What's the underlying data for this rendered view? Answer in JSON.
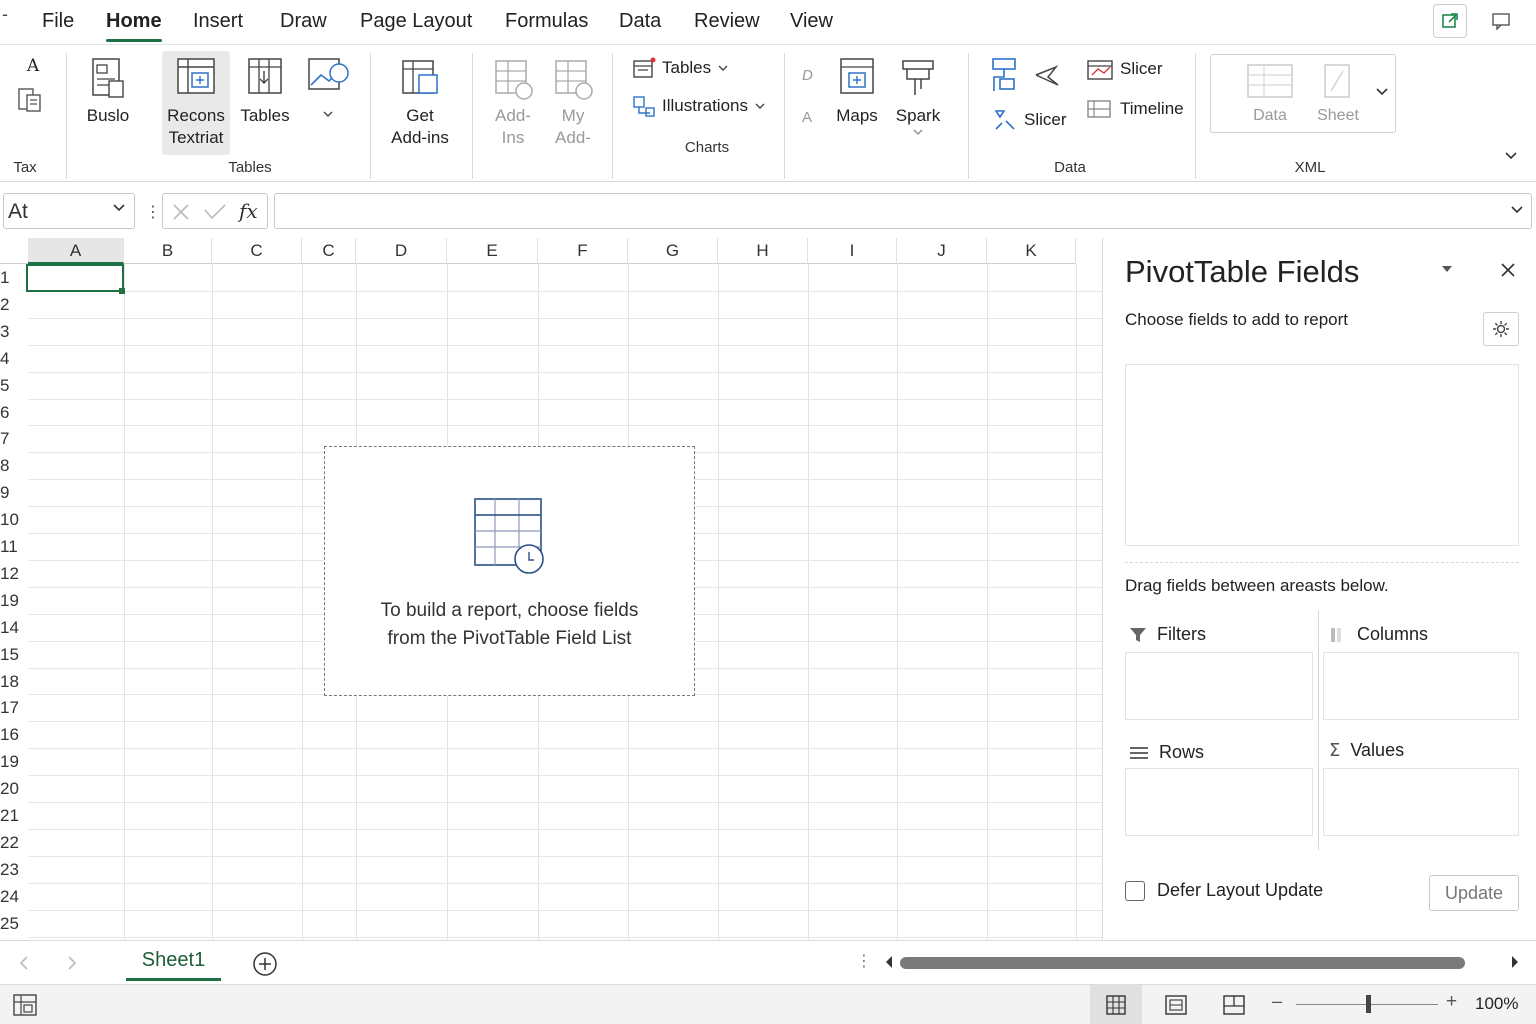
{
  "menubar": {
    "dash": "-",
    "tabs": [
      "File",
      "Home",
      "Insert",
      "Draw",
      "Page Layout",
      "Formulas",
      "Data",
      "Review",
      "View"
    ],
    "active_tab": "Home"
  },
  "ribbon": {
    "tax_group": {
      "icon_letter": "A",
      "label": "Tax"
    },
    "tables_group": {
      "buslo": "Buslo",
      "recons_line1": "Recons",
      "recons_line2": "Textriat",
      "tables": "Tables",
      "label": "Tables"
    },
    "addins_group": {
      "get_line1": "Get",
      "get_line2": "Add-ins",
      "addins_line1": "Add-",
      "addins_line2": "Ins",
      "my_line1": "My",
      "my_line2": "Add-"
    },
    "charts_group": {
      "tables": "Tables",
      "illustrations": "Illustrations",
      "label": "Charts"
    },
    "data_group": {
      "letter_d": "D",
      "letter_a": "A",
      "maps": "Maps",
      "spark": "Spark",
      "slicer_small": "Slicer",
      "slicer_top": "Slicer",
      "timeline": "Timeline",
      "label": "Data"
    },
    "xml_group": {
      "data": "Data",
      "sheet": "Sheet",
      "label": "XML"
    }
  },
  "formulabar": {
    "namebox": "At",
    "fx": "fx",
    "value": ""
  },
  "grid": {
    "columns": [
      "A",
      "B",
      "C",
      "C",
      "D",
      "E",
      "F",
      "G",
      "H",
      "I",
      "J",
      "K"
    ],
    "rows": [
      "1",
      "2",
      "3",
      "4",
      "5",
      "6",
      "7",
      "8",
      "9",
      "10",
      "11",
      "12",
      "19",
      "14",
      "15",
      "18",
      "17",
      "16",
      "19",
      "20",
      "21",
      "22",
      "23",
      "24",
      "25"
    ],
    "selected_column": "A",
    "placeholder": {
      "line1": "To build a report, choose fields",
      "line2": "from the PivotTable Field List"
    }
  },
  "pivot_pane": {
    "title": "PivotTable Fields",
    "subtitle": "Choose fields to add to report",
    "drag_text": "Drag fields between areasts below.",
    "areas": {
      "filters": "Filters",
      "columns": "Columns",
      "rows": "Rows",
      "values": "Values"
    },
    "defer_label": "Defer Layout Update",
    "defer_checked": false,
    "update_button": "Update"
  },
  "sheet_tabs": {
    "active": "Sheet1"
  },
  "statusbar": {
    "zoom": "100%"
  },
  "colors": {
    "accent": "#1e7145",
    "share_icon": "#1e8a4c"
  }
}
